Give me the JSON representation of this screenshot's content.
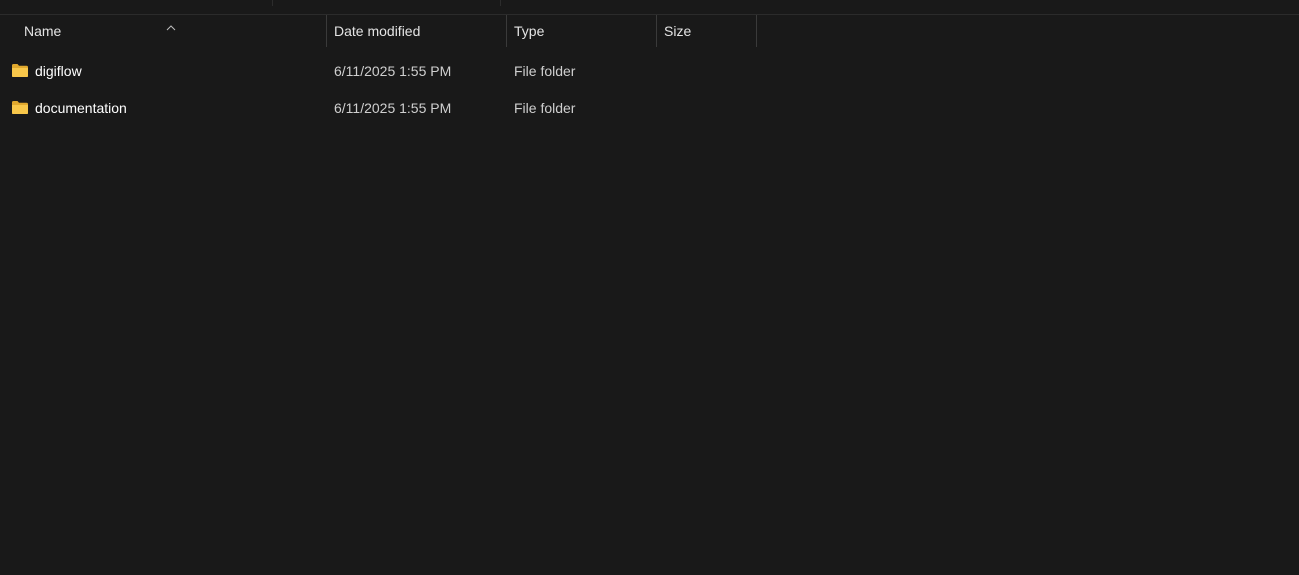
{
  "columns": {
    "name": "Name",
    "date_modified": "Date modified",
    "type": "Type",
    "size": "Size"
  },
  "sort": {
    "column": "name",
    "direction": "ascending",
    "icon": "chevron-up-icon"
  },
  "items": [
    {
      "icon": "folder-icon",
      "name": "digiflow",
      "date_modified": "6/11/2025 1:55 PM",
      "type": "File folder",
      "size": ""
    },
    {
      "icon": "folder-icon",
      "name": "documentation",
      "date_modified": "6/11/2025 1:55 PM",
      "type": "File folder",
      "size": ""
    }
  ],
  "colors": {
    "background": "#191919",
    "folder": "#f8c74a",
    "text": "#ffffff",
    "secondary_text": "#cfcfcf"
  }
}
